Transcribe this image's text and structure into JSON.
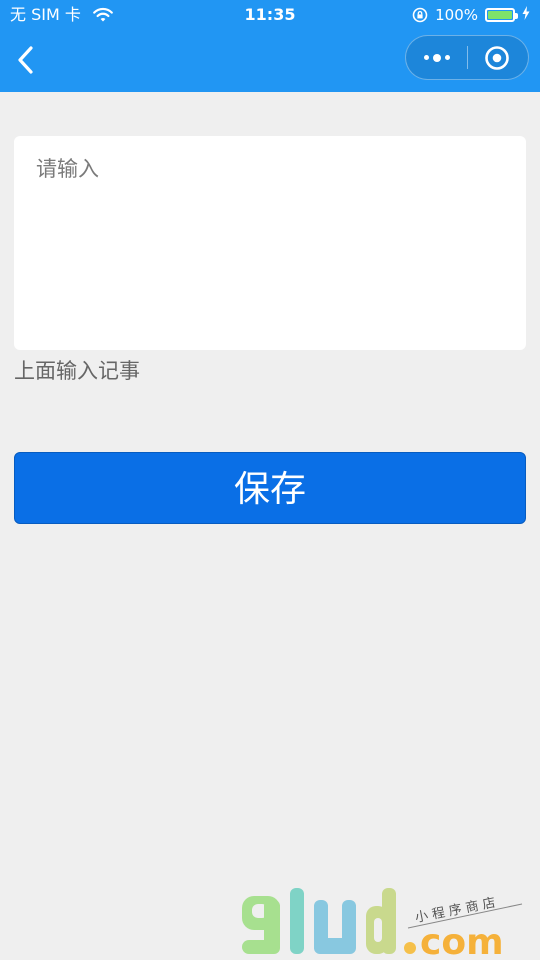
{
  "status_bar": {
    "carrier": "无 SIM 卡",
    "time": "11:35",
    "battery_percent": "100%",
    "battery_level": 1.0
  },
  "nav": {
    "back_icon": "chevron-left-icon",
    "more_icon": "more-dots-icon",
    "close_icon": "target-circle-icon"
  },
  "form": {
    "placeholder": "请输入",
    "value": "",
    "hint": "上面输入记事",
    "save_label": "保存"
  },
  "watermark": {
    "logo_text": "91ud.com",
    "tagline": "小程序商店"
  },
  "colors": {
    "header": "#2196f3",
    "background": "#efefef",
    "button": "#0a6fe6"
  }
}
